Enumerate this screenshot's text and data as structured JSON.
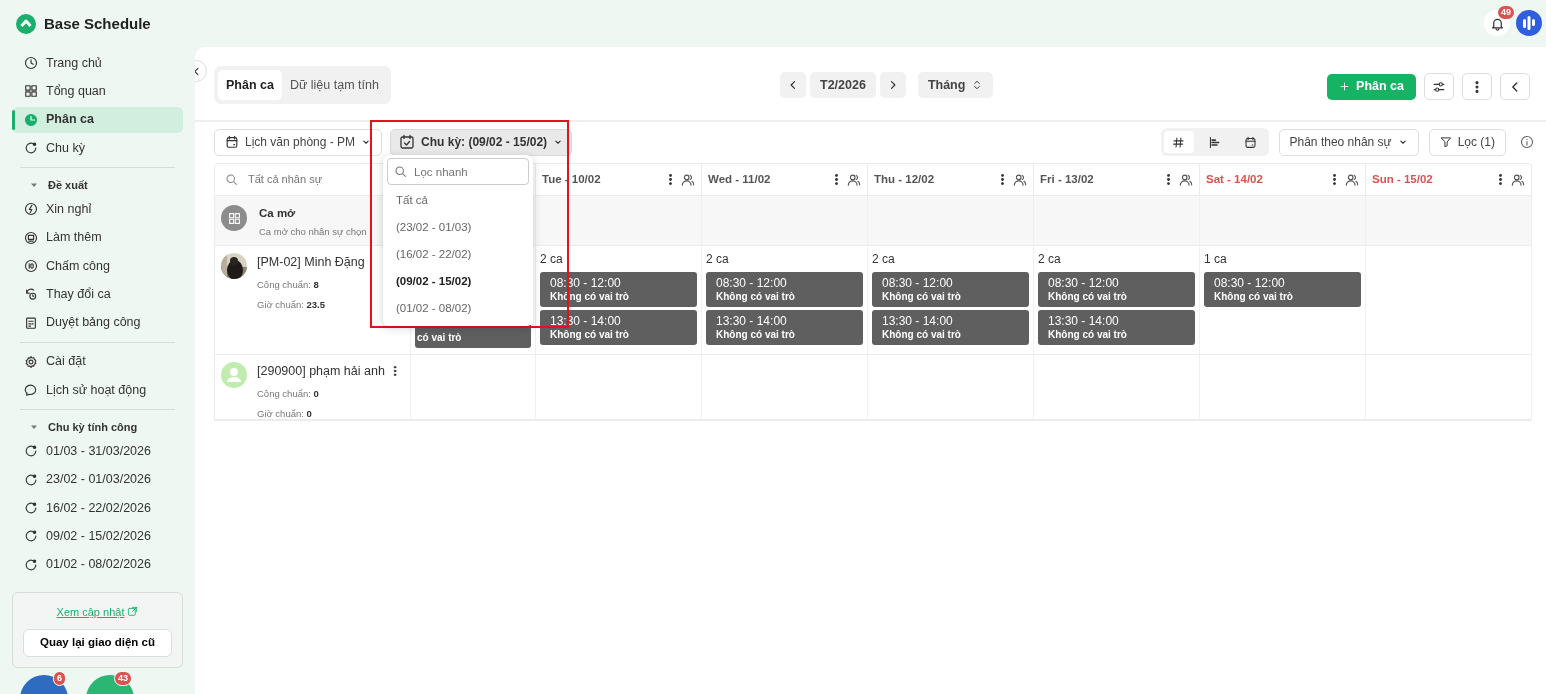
{
  "app": {
    "title": "Base Schedule",
    "notifications": "49"
  },
  "sidebar": {
    "items": [
      {
        "kind": "clock",
        "label": "Trang chủ",
        "selected": false
      },
      {
        "kind": "grid",
        "label": "Tổng quan",
        "selected": false
      },
      {
        "kind": "pie",
        "label": "Phân ca",
        "selected": true
      },
      {
        "kind": "cycle",
        "label": "Chu kỳ",
        "selected": false
      }
    ],
    "sections": [
      {
        "title": "Đề xuất",
        "expanded": true,
        "items": [
          {
            "kind": "bolt",
            "label": "Xin nghỉ"
          },
          {
            "kind": "monitor",
            "label": "Làm thêm"
          },
          {
            "kind": "id",
            "label": "Chấm công"
          },
          {
            "kind": "swap",
            "label": "Thay đổi ca"
          },
          {
            "kind": "sheet",
            "label": "Duyệt bảng công"
          }
        ]
      },
      {
        "items": [
          {
            "kind": "gear",
            "label": "Cài đặt"
          },
          {
            "kind": "history",
            "label": "Lịch sử hoạt động"
          }
        ]
      },
      {
        "title": "Chu kỳ tính công",
        "expanded": true,
        "items": [
          {
            "kind": "cycle",
            "label": "01/03 - 31/03/2026"
          },
          {
            "kind": "cycle",
            "label": "23/02 - 01/03/2026"
          },
          {
            "kind": "cycle",
            "label": "16/02 - 22/02/2026"
          },
          {
            "kind": "cycle",
            "label": "09/02 - 15/02/2026"
          },
          {
            "kind": "cycle",
            "label": "01/02 - 08/02/2026"
          }
        ]
      }
    ],
    "update_link": "Xem cập nhật",
    "old_ui_button": "Quay lại giao diện cũ",
    "floating_badges": [
      {
        "count": "6",
        "color": "#2d6cc0"
      },
      {
        "count": "43",
        "color": "#2bb673"
      }
    ]
  },
  "tabs": [
    {
      "label": "Phân ca",
      "selected": true
    },
    {
      "label": "Dữ liệu tạm tính",
      "selected": false
    }
  ],
  "period": {
    "label": "T2/2026",
    "mode": "Tháng"
  },
  "add_button": "Phân ca",
  "toolbar": {
    "calendar": "Lịch văn phòng - PM",
    "cycle": "Chu kỳ: (09/02 - 15/02)",
    "view_modes": [
      {
        "kind": "hash",
        "selected": true
      },
      {
        "kind": "gantt",
        "selected": false
      },
      {
        "kind": "calendar",
        "selected": false
      }
    ],
    "group_by": "Phân theo nhân sự",
    "filter": "Lọc (1)"
  },
  "cycle_dropdown": {
    "highlighted": true,
    "placeholder": "Lọc nhanh",
    "options": [
      {
        "label": "Tất cả",
        "selected": false
      },
      {
        "label": "(23/02 - 01/03)",
        "selected": false
      },
      {
        "label": "(16/02 - 22/02)",
        "selected": false
      },
      {
        "label": "(09/02 - 15/02)",
        "selected": true
      },
      {
        "label": "(01/02 - 08/02)",
        "selected": false
      }
    ]
  },
  "table": {
    "search_placeholder": "Tất cả nhân sự",
    "columns": [
      {},
      {
        "label": "Tue - 10/02",
        "weekend": false
      },
      {
        "label": "Wed - 11/02",
        "weekend": false
      },
      {
        "label": "Thu - 12/02",
        "weekend": false
      },
      {
        "label": "Fri - 13/02",
        "weekend": false
      },
      {
        "label": "Sat - 14/02",
        "weekend": true
      },
      {
        "label": "Sun - 15/02",
        "weekend": true
      }
    ],
    "open_shift": {
      "title": "Ca mở",
      "subtitle": "Ca mở cho nhân sự chọn"
    },
    "rows": [
      {
        "photo": true,
        "name": "[PM-02] Minh Đặng",
        "menu": false,
        "stats": [
          "Công chuẩn: **8**",
          "Giờ chuẩn: **23.5**"
        ],
        "cells": [
          {
            "shifts": [
              {
                "role": "có vai trò"
              }
            ]
          },
          {
            "count": "2 ca",
            "shifts": [
              {
                "time": "08:30 - 12:00",
                "role": "Không có vai trò"
              },
              {
                "time": "13:30 - 14:00",
                "role": "Không có vai trò"
              }
            ]
          },
          {
            "count": "2 ca",
            "shifts": [
              {
                "time": "08:30 - 12:00",
                "role": "Không có vai trò"
              },
              {
                "time": "13:30 - 14:00",
                "role": "Không có vai trò"
              }
            ]
          },
          {
            "count": "2 ca",
            "shifts": [
              {
                "time": "08:30 - 12:00",
                "role": "Không có vai trò"
              },
              {
                "time": "13:30 - 14:00",
                "role": "Không có vai trò"
              }
            ]
          },
          {
            "count": "2 ca",
            "shifts": [
              {
                "time": "08:30 - 12:00",
                "role": "Không có vai trò"
              },
              {
                "time": "13:30 - 14:00",
                "role": "Không có vai trò"
              }
            ]
          },
          {
            "count": "1 ca",
            "shifts": [
              {
                "time": "08:30 - 12:00",
                "role": "Không có vai trò"
              }
            ]
          },
          {}
        ]
      },
      {
        "photo": false,
        "name": "[290900] phạm hải anh",
        "menu": true,
        "stats": [
          "Công chuẩn: **0**",
          "Giờ chuẩn: **0**"
        ],
        "cells": [
          {},
          {},
          {},
          {},
          {},
          {},
          {}
        ]
      }
    ]
  }
}
